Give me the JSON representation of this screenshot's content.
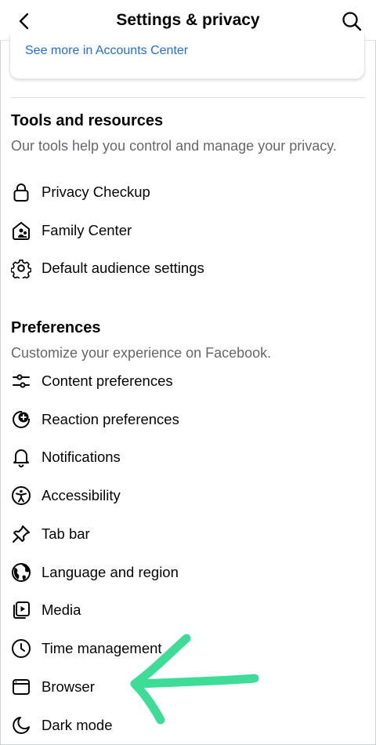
{
  "header": {
    "title": "Settings & privacy",
    "back_icon": "chevron-left-icon",
    "search_icon": "search-icon"
  },
  "accounts": {
    "link_label": "See more in Accounts Center",
    "link_color": "#216fdb"
  },
  "tools": {
    "title": "Tools and resources",
    "description": "Our tools help you control and manage your privacy.",
    "items": [
      {
        "label": "Privacy Checkup",
        "icon": "lock-icon"
      },
      {
        "label": "Family Center",
        "icon": "family-home-icon"
      },
      {
        "label": "Default audience settings",
        "icon": "gear-icon"
      }
    ]
  },
  "preferences": {
    "title": "Preferences",
    "description": "Customize your experience on Facebook.",
    "items": [
      {
        "label": "Content preferences",
        "icon": "sliders-icon"
      },
      {
        "label": "Reaction preferences",
        "icon": "reaction-icon"
      },
      {
        "label": "Notifications",
        "icon": "bell-icon"
      },
      {
        "label": "Accessibility",
        "icon": "accessibility-icon"
      },
      {
        "label": "Tab bar",
        "icon": "pin-icon"
      },
      {
        "label": "Language and region",
        "icon": "globe-icon"
      },
      {
        "label": "Media",
        "icon": "media-play-icon"
      },
      {
        "label": "Time management",
        "icon": "clock-icon"
      },
      {
        "label": "Browser",
        "icon": "browser-window-icon"
      },
      {
        "label": "Dark mode",
        "icon": "moon-icon"
      }
    ]
  },
  "annotation": {
    "arrow_color": "#3ddc97",
    "icon": "hand-drawn-arrow-icon"
  }
}
